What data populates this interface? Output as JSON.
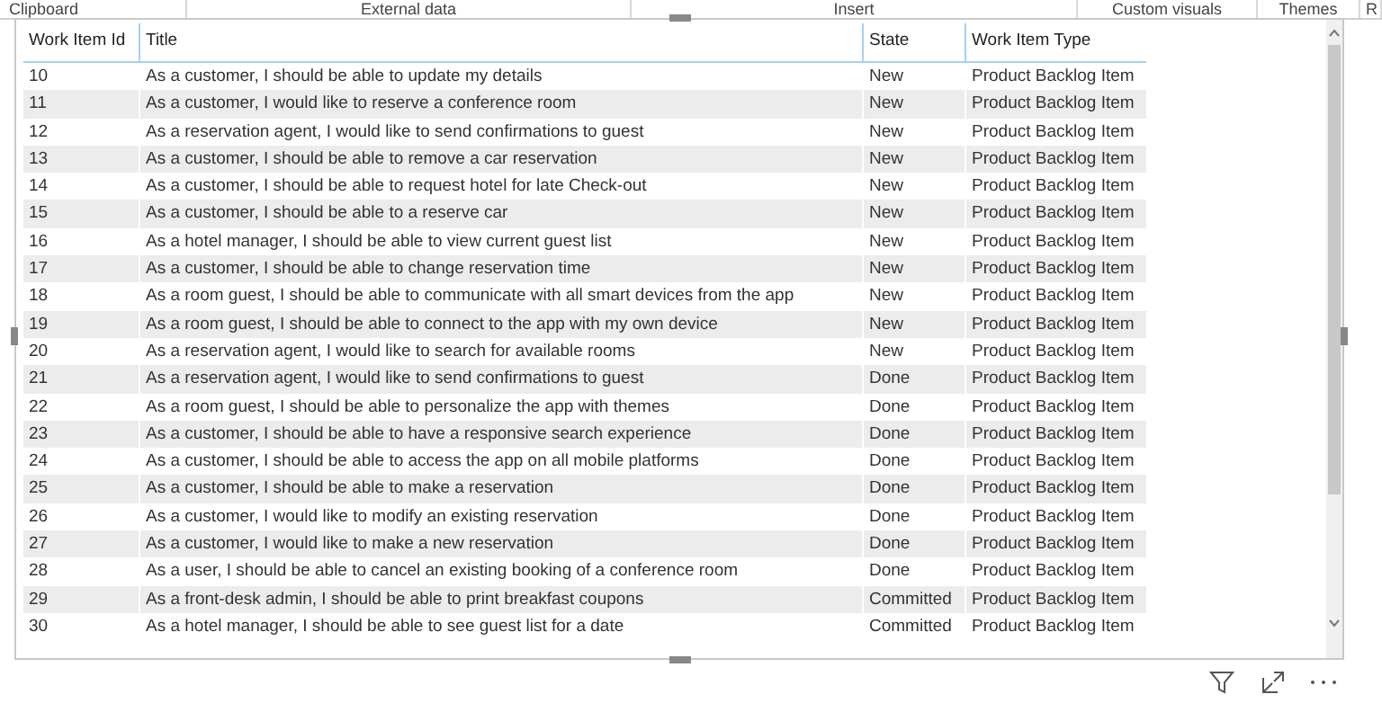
{
  "ribbon": {
    "groups": [
      "Clipboard",
      "External data",
      "Insert",
      "Custom visuals",
      "Themes",
      "R"
    ]
  },
  "table": {
    "columns": [
      "Work Item Id",
      "Title",
      "State",
      "Work Item Type"
    ],
    "rows": [
      [
        "10",
        "As a customer, I should be able to update my details",
        "New",
        "Product Backlog Item"
      ],
      [
        "11",
        "As a customer, I would like to reserve a conference room",
        "New",
        "Product Backlog Item"
      ],
      [
        "12",
        "As a reservation agent, I would like to send confirmations to guest",
        "New",
        "Product Backlog Item"
      ],
      [
        "13",
        "As a customer, I should be able to remove a car reservation",
        "New",
        "Product Backlog Item"
      ],
      [
        "14",
        "As a customer, I should be able to request hotel for late Check-out",
        "New",
        "Product Backlog Item"
      ],
      [
        "15",
        "As a customer, I should be able to a reserve car",
        "New",
        "Product Backlog Item"
      ],
      [
        "16",
        "As a hotel manager, I should be able to view current guest list",
        "New",
        "Product Backlog Item"
      ],
      [
        "17",
        "As a customer, I should be able to change reservation time",
        "New",
        "Product Backlog Item"
      ],
      [
        "18",
        "As a room guest, I should be able to communicate with all smart devices from the app",
        "New",
        "Product Backlog Item"
      ],
      [
        "19",
        "As a room guest, I should be able to connect to the app with my own device",
        "New",
        "Product Backlog Item"
      ],
      [
        "20",
        "As a reservation agent, I would like to search for available rooms",
        "New",
        "Product Backlog Item"
      ],
      [
        "21",
        "As a reservation agent, I would like to send confirmations to guest",
        "Done",
        "Product Backlog Item"
      ],
      [
        "22",
        "As a room guest, I should be able to personalize the app with themes",
        "Done",
        "Product Backlog Item"
      ],
      [
        "23",
        "As a customer, I should be able to have a responsive search experience",
        "Done",
        "Product Backlog Item"
      ],
      [
        "24",
        "As a customer, I should be able to access the app on all mobile platforms",
        "Done",
        "Product Backlog Item"
      ],
      [
        "25",
        "As a customer, I should be able to make a reservation",
        "Done",
        "Product Backlog Item"
      ],
      [
        "26",
        "As a customer, I would like to modify an existing reservation",
        "Done",
        "Product Backlog Item"
      ],
      [
        "27",
        "As a customer, I would like to make a new reservation",
        "Done",
        "Product Backlog Item"
      ],
      [
        "28",
        "As a user, I should be able to cancel an existing booking of a conference room",
        "Done",
        "Product Backlog Item"
      ],
      [
        "29",
        "As a front-desk admin, I should be able to print breakfast coupons",
        "Committed",
        "Product Backlog Item"
      ],
      [
        "30",
        "As a hotel manager, I should be able to see guest list for a date",
        "Committed",
        "Product Backlog Item"
      ]
    ]
  }
}
